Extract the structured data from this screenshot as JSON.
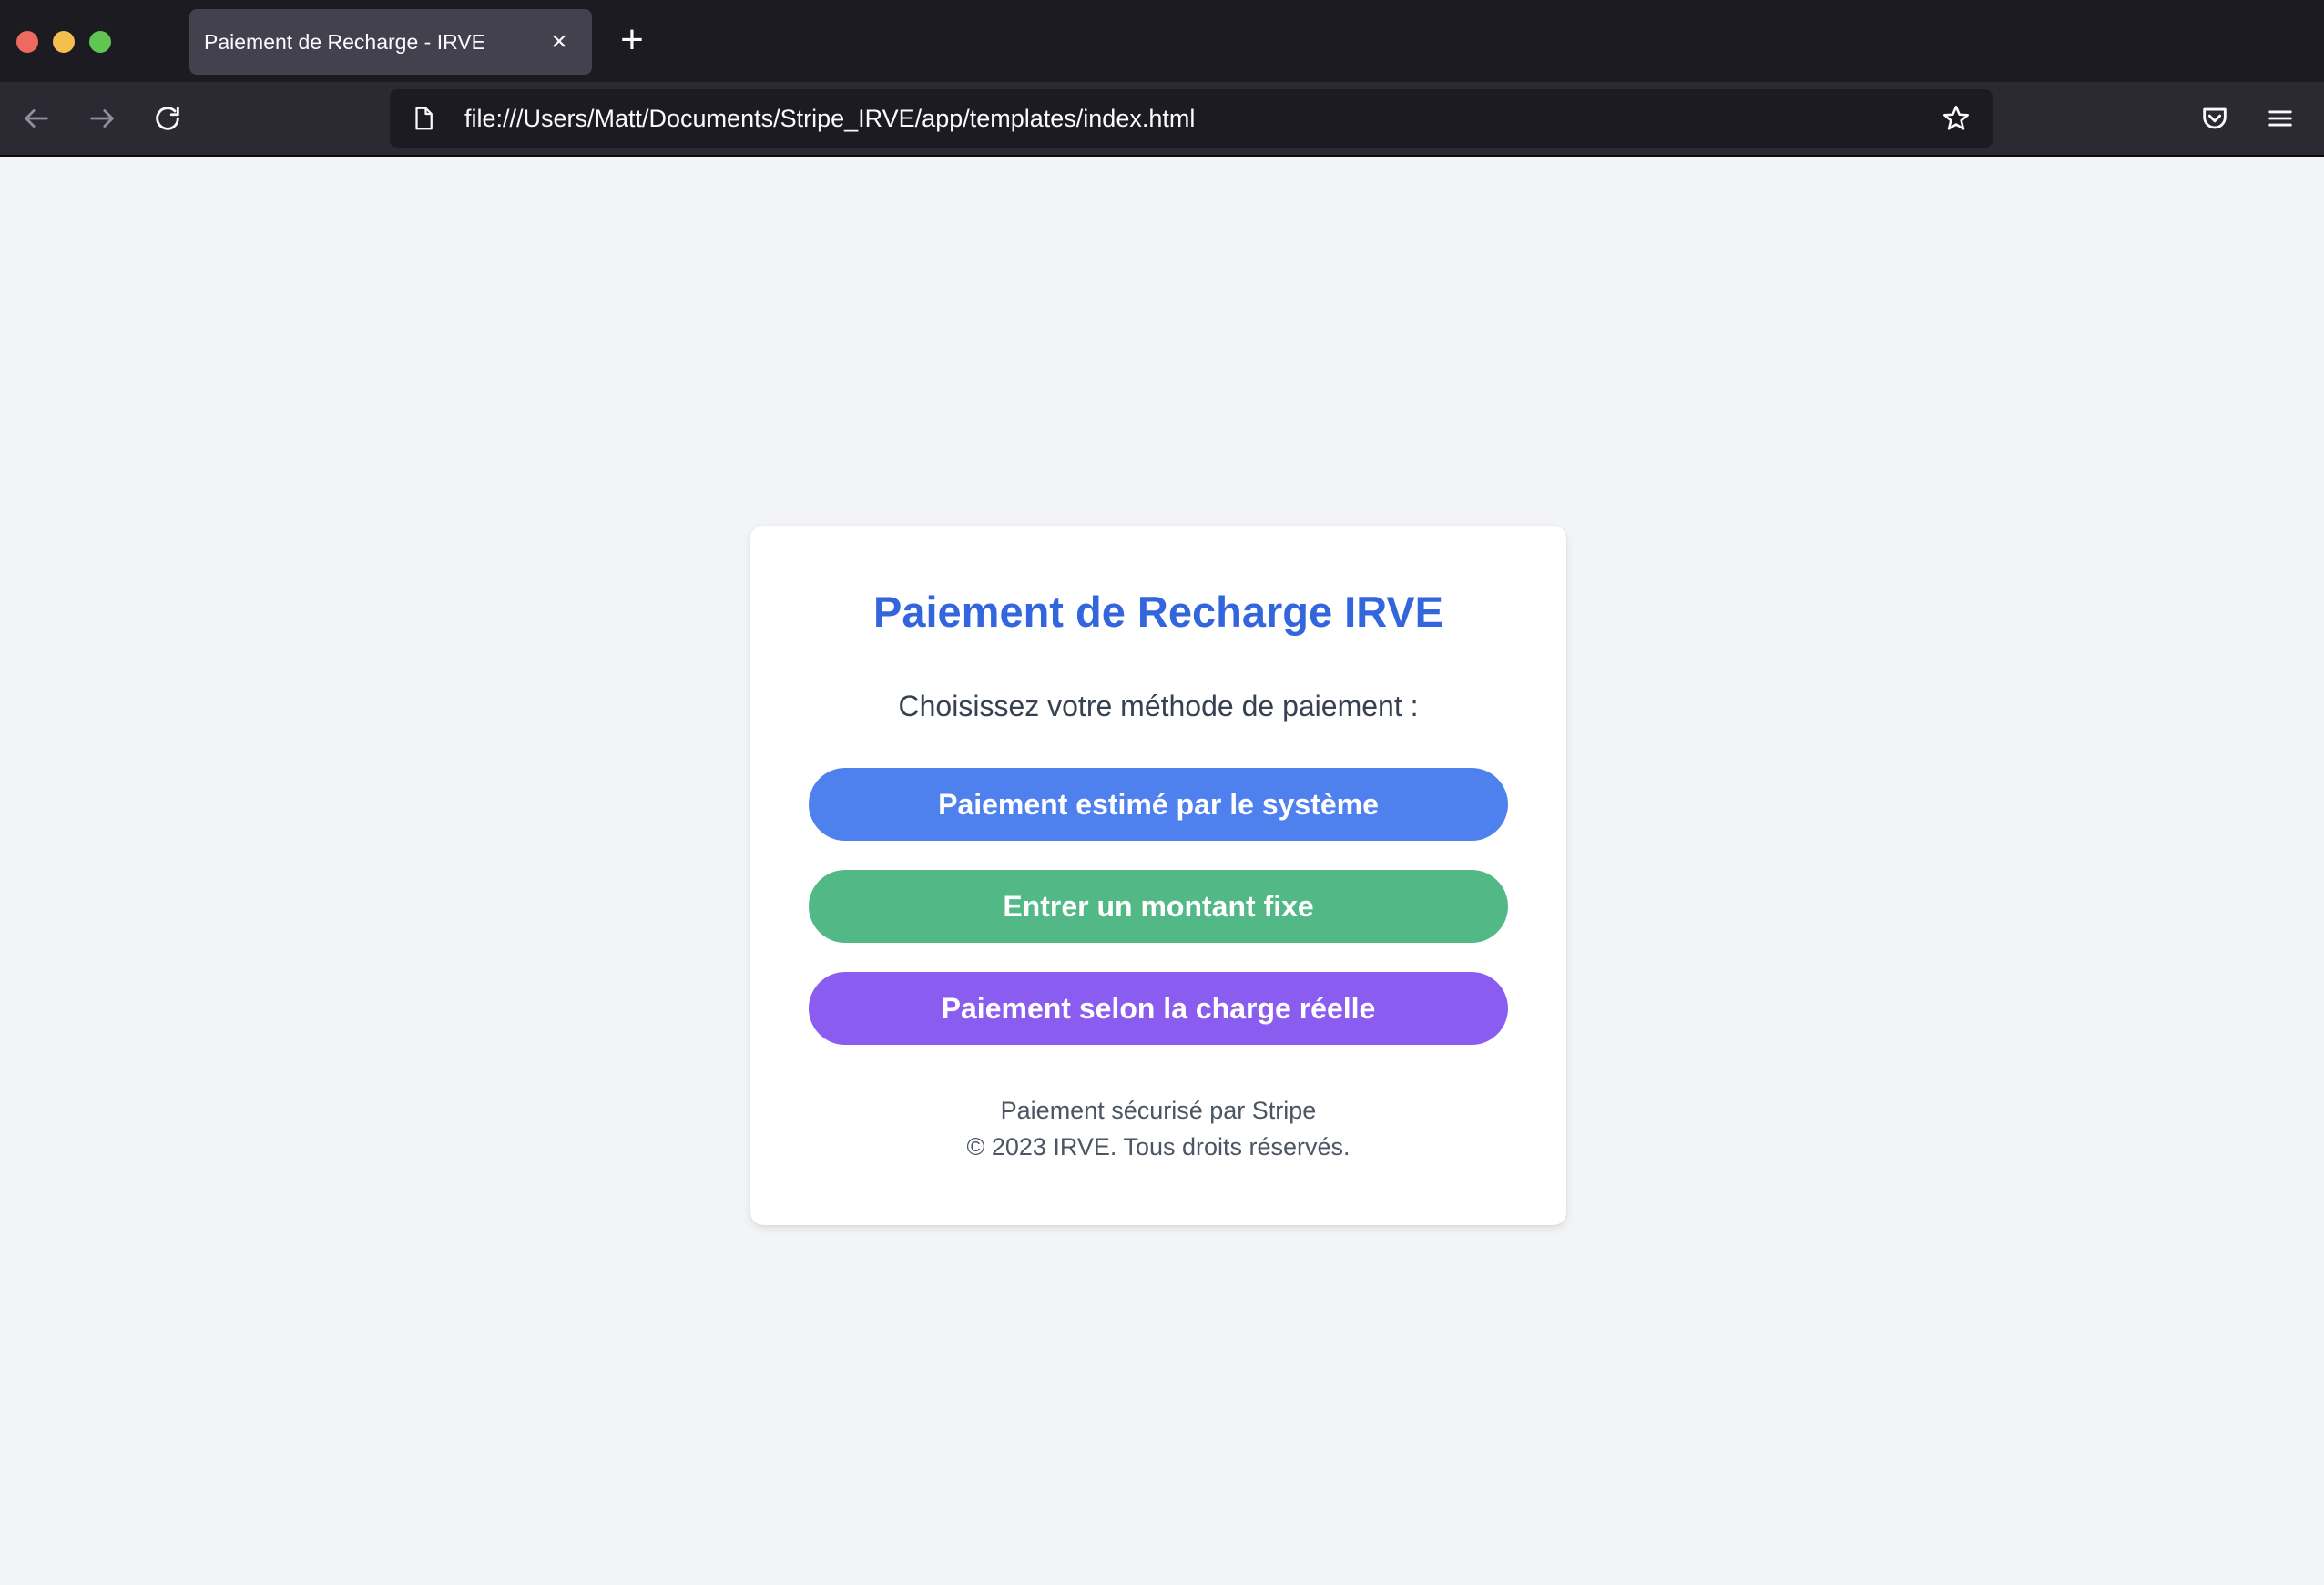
{
  "browser": {
    "tab": {
      "title": "Paiement de Recharge - IRVE",
      "close_glyph": "×"
    },
    "new_tab_glyph": "+",
    "url": "file:///Users/Matt/Documents/Stripe_IRVE/app/templates/index.html"
  },
  "page": {
    "title": "Paiement de Recharge IRVE",
    "subtitle": "Choisissez votre méthode de paiement :",
    "buttons": {
      "estimated": "Paiement estimé par le système",
      "fixed": "Entrer un montant fixe",
      "actual": "Paiement selon la charge réelle"
    },
    "footer": {
      "secured": "Paiement sécurisé par Stripe",
      "copyright": "© 2023 IRVE. Tous droits réservés."
    }
  },
  "colors": {
    "title": "#3366dd",
    "button_estimated": "#4f81ee",
    "button_fixed": "#52b986",
    "button_actual": "#8a5cf0",
    "page_background": "#f3f4f6"
  },
  "icons": {
    "back": "arrow-left-icon",
    "forward": "arrow-right-icon",
    "reload": "reload-icon",
    "page": "page-icon",
    "bookmark": "star-icon",
    "pocket": "pocket-icon",
    "menu": "hamburger-menu-icon"
  }
}
